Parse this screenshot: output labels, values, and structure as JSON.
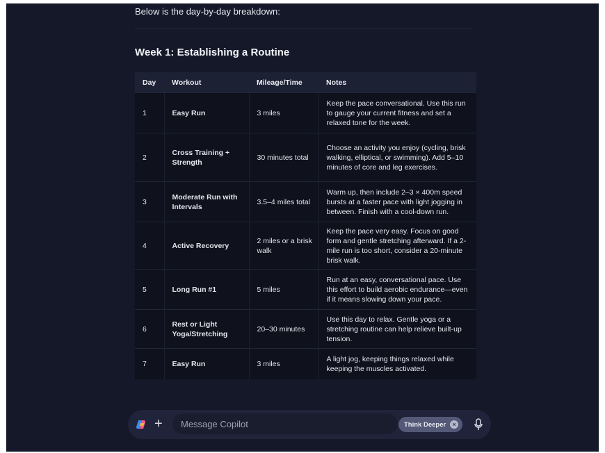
{
  "intro_text": "Below is the day-by-day breakdown:",
  "week_title": "Week 1: Establishing a Routine",
  "table": {
    "headers": [
      "Day",
      "Workout",
      "Mileage/Time",
      "Notes"
    ],
    "rows": [
      {
        "day": "1",
        "workout": "Easy Run",
        "mileage": "3 miles",
        "notes": "Keep the pace conversational. Use this run to gauge your current fitness and set a relaxed tone for the week."
      },
      {
        "day": "2",
        "workout": "Cross Training + Strength",
        "mileage": "30 minutes total",
        "notes": "Choose an activity you enjoy (cycling, brisk walking, elliptical, or swimming). Add 5–10 minutes of core and leg exercises."
      },
      {
        "day": "3",
        "workout": "Moderate Run with Intervals",
        "mileage": "3.5–4 miles total",
        "notes": "Warm up, then include 2–3 × 400m speed bursts at a faster pace with light jogging in between. Finish with a cool-down run."
      },
      {
        "day": "4",
        "workout": "Active Recovery",
        "mileage": "2 miles or a brisk walk",
        "notes": "Keep the pace very easy. Focus on good form and gentle stretching afterward. If a 2-mile run is too short, consider a 20-minute brisk walk."
      },
      {
        "day": "5",
        "workout": "Long Run #1",
        "mileage": "5 miles",
        "notes": "Run at an easy, conversational pace. Use this effort to build aerobic endurance—even if it means slowing down your pace."
      },
      {
        "day": "6",
        "workout": "Rest or Light Yoga/Stretching",
        "mileage": "20–30 minutes",
        "notes": "Use this day to relax. Gentle yoga or a stretching routine can help relieve built-up tension."
      },
      {
        "day": "7",
        "workout": "Easy Run",
        "mileage": "3 miles",
        "notes": "A light jog, keeping things relaxed while keeping the muscles activated."
      }
    ]
  },
  "composer": {
    "placeholder": "Message Copilot",
    "think_deeper_label": "Think Deeper",
    "close_glyph": "×",
    "plus_glyph": "+"
  },
  "icons": {
    "logo": "copilot-logo-icon",
    "plus": "plus-icon",
    "close": "close-icon",
    "mic": "microphone-icon"
  },
  "colors": {
    "background": "#151828",
    "table_header": "#1d2134",
    "table_body": "#0f111c",
    "composer": "#20243a",
    "think_deeper_pill": "#535976"
  }
}
